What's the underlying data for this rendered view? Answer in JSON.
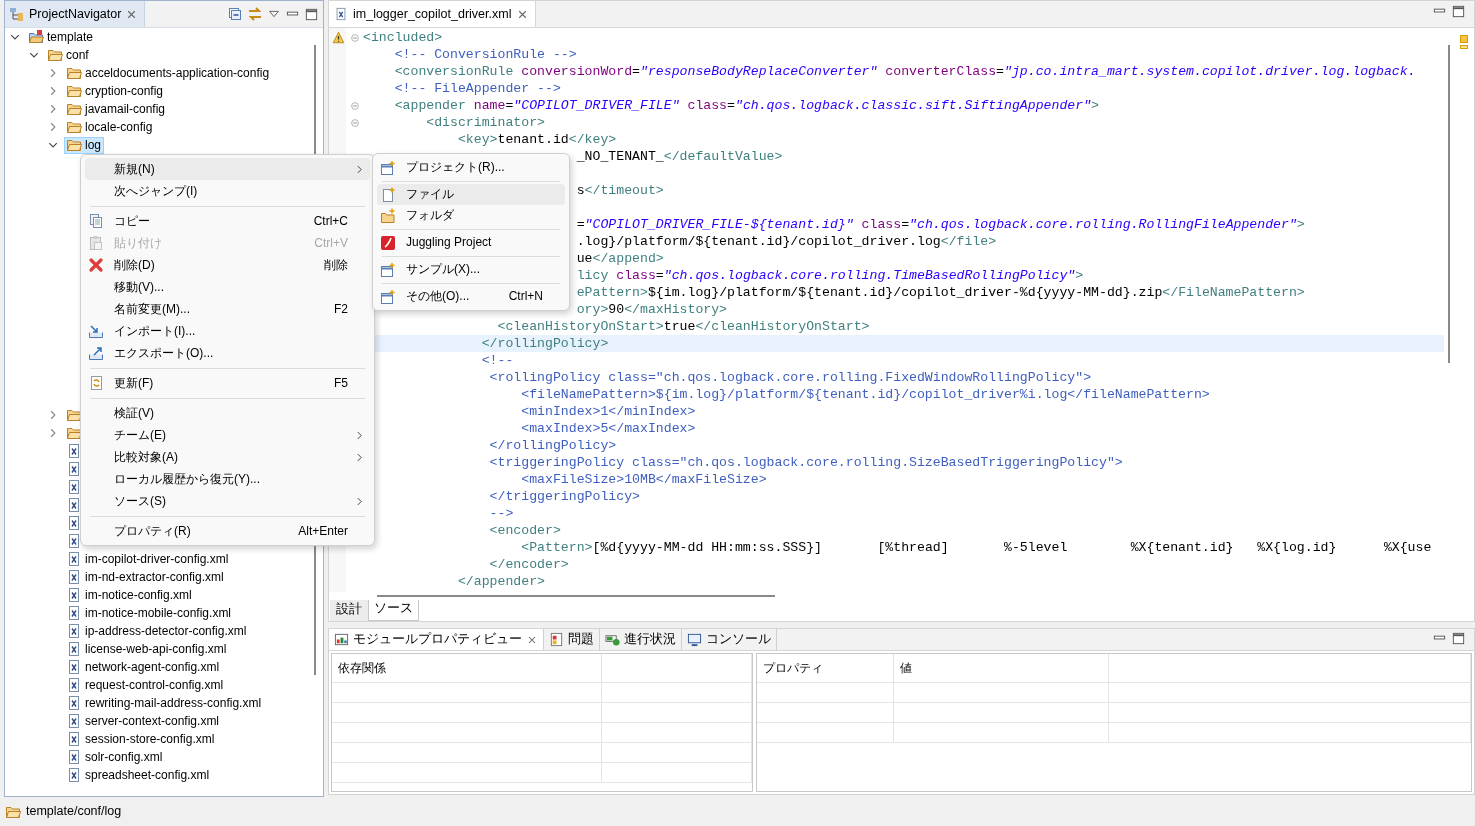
{
  "navigator": {
    "title": "ProjectNavigator",
    "tree": [
      {
        "kind": "project",
        "label": "template",
        "expanded": true,
        "selected": false,
        "children": [
          {
            "kind": "folder",
            "label": "conf",
            "expanded": true,
            "selected": false,
            "children": [
              {
                "kind": "folder",
                "label": "acceldocuments-application-config",
                "expanded": false,
                "selected": false
              },
              {
                "kind": "folder",
                "label": "cryption-config",
                "expanded": false,
                "selected": false
              },
              {
                "kind": "folder",
                "label": "javamail-config",
                "expanded": false,
                "selected": false
              },
              {
                "kind": "folder",
                "label": "locale-config",
                "expanded": false,
                "selected": false
              },
              {
                "kind": "folder",
                "label": "log",
                "expanded": true,
                "selected": true
              },
              {
                "kind": "folder",
                "expanded": false,
                "selected": false
              },
              {
                "kind": "folder",
                "expanded": false,
                "selected": false
              },
              {
                "kind": "file",
                "selected": false
              },
              {
                "kind": "file",
                "selected": false
              },
              {
                "kind": "file",
                "selected": false
              },
              {
                "kind": "file",
                "selected": false
              },
              {
                "kind": "file",
                "selected": false
              },
              {
                "kind": "file",
                "selected": false
              },
              {
                "kind": "file",
                "label": "im-copilot-driver-config.xml",
                "selected": false
              },
              {
                "kind": "file",
                "label": "im-nd-extractor-config.xml",
                "selected": false
              },
              {
                "kind": "file",
                "label": "im-notice-config.xml",
                "selected": false
              },
              {
                "kind": "file",
                "label": "im-notice-mobile-config.xml",
                "selected": false
              },
              {
                "kind": "file",
                "label": "ip-address-detector-config.xml",
                "selected": false
              },
              {
                "kind": "file",
                "label": "license-web-api-config.xml",
                "selected": false
              },
              {
                "kind": "file",
                "label": "network-agent-config.xml",
                "selected": false
              },
              {
                "kind": "file",
                "label": "request-control-config.xml",
                "selected": false
              },
              {
                "kind": "file",
                "label": "rewriting-mail-address-config.xml",
                "selected": false
              },
              {
                "kind": "file",
                "label": "server-context-config.xml",
                "selected": false
              },
              {
                "kind": "file",
                "label": "session-store-config.xml",
                "selected": false
              },
              {
                "kind": "file",
                "label": "solr-config.xml",
                "selected": false
              },
              {
                "kind": "file",
                "label": "spreadsheet-config.xml",
                "selected": false
              }
            ]
          }
        ]
      }
    ]
  },
  "editor": {
    "tab": {
      "title": "im_logger_copilot_driver.xml"
    },
    "lines": [
      {
        "segments": [
          {
            "kind": "tag",
            "text": "<included>"
          }
        ],
        "fold": true,
        "warning": true,
        "current": false
      },
      {
        "segments": [
          {
            "kind": "comment",
            "text": "    <!-- ConversionRule -->"
          }
        ],
        "fold": false,
        "warning": false,
        "current": false
      },
      {
        "segments": [
          {
            "kind": "tag",
            "text": "    <conversionRule "
          },
          {
            "kind": "attr",
            "text": "conversionWord"
          },
          {
            "kind": "text",
            "text": "="
          },
          {
            "kind": "value",
            "text": "\"responseBodyReplaceConverter\" "
          },
          {
            "kind": "attr",
            "text": "converterClass"
          },
          {
            "kind": "text",
            "text": "="
          },
          {
            "kind": "value",
            "text": "\"jp.co.intra_mart.system.copilot.driver.log.logback."
          }
        ],
        "fold": false,
        "warning": false,
        "current": false
      },
      {
        "segments": [
          {
            "kind": "comment",
            "text": "    <!-- FileAppender -->"
          }
        ],
        "fold": false,
        "warning": false,
        "current": false
      },
      {
        "segments": [
          {
            "kind": "tag",
            "text": "    <appender "
          },
          {
            "kind": "attr",
            "text": "name"
          },
          {
            "kind": "text",
            "text": "="
          },
          {
            "kind": "value",
            "text": "\"COPILOT_DRIVER_FILE\" "
          },
          {
            "kind": "attr",
            "text": "class"
          },
          {
            "kind": "text",
            "text": "="
          },
          {
            "kind": "value",
            "text": "\"ch.qos.logback.classic.sift.SiftingAppender\""
          },
          {
            "kind": "tag",
            "text": ">"
          }
        ],
        "fold": true,
        "warning": false,
        "current": false
      },
      {
        "segments": [
          {
            "kind": "tag",
            "text": "        <discriminator>"
          }
        ],
        "fold": true,
        "warning": false,
        "current": false
      },
      {
        "segments": [
          {
            "kind": "tag",
            "text": "            <key>"
          },
          {
            "kind": "text",
            "text": "tenant.id"
          },
          {
            "kind": "tag",
            "text": "</key>"
          }
        ],
        "fold": false,
        "warning": false,
        "current": false
      },
      {
        "segments": [
          {
            "kind": "text",
            "text": "                           _NO_TENANT_"
          },
          {
            "kind": "tag",
            "text": "</defaultValue>"
          }
        ],
        "fold": false,
        "warning": false,
        "current": false
      },
      {
        "fold": false,
        "warning": false,
        "current": false
      },
      {
        "segments": [
          {
            "kind": "text",
            "text": "                           s"
          },
          {
            "kind": "tag",
            "text": "</timeout>"
          }
        ],
        "fold": false,
        "warning": false,
        "current": false
      },
      {
        "fold": false,
        "warning": false,
        "current": false
      },
      {
        "segments": [
          {
            "kind": "text",
            "text": "                           ="
          },
          {
            "kind": "value",
            "text": "\"COPILOT_DRIVER_FILE-${tenant.id}\" "
          },
          {
            "kind": "attr",
            "text": "class"
          },
          {
            "kind": "text",
            "text": "="
          },
          {
            "kind": "value",
            "text": "\"ch.qos.logback.core.rolling.RollingFileAppender\""
          },
          {
            "kind": "tag",
            "text": ">"
          }
        ],
        "fold": false,
        "warning": false,
        "current": false
      },
      {
        "segments": [
          {
            "kind": "text",
            "text": "                           .log}/platform/${tenant.id}/copilot_driver.log"
          },
          {
            "kind": "tag",
            "text": "</file>"
          }
        ],
        "fold": false,
        "warning": false,
        "current": false
      },
      {
        "segments": [
          {
            "kind": "text",
            "text": "                           ue"
          },
          {
            "kind": "tag",
            "text": "</append>"
          }
        ],
        "fold": false,
        "warning": false,
        "current": false
      },
      {
        "segments": [
          {
            "kind": "tag",
            "text": "                           licy "
          },
          {
            "kind": "attr",
            "text": "class"
          },
          {
            "kind": "text",
            "text": "="
          },
          {
            "kind": "value",
            "text": "\"ch.qos.logback.core.rolling.TimeBasedRollingPolicy\""
          },
          {
            "kind": "tag",
            "text": ">"
          }
        ],
        "fold": false,
        "warning": false,
        "current": false
      },
      {
        "segments": [
          {
            "kind": "tag",
            "text": "                           ePattern>"
          },
          {
            "kind": "text",
            "text": "${im.log}/platform/${tenant.id}/copilot_driver-%d{yyyy-MM-dd}.zip"
          },
          {
            "kind": "tag",
            "text": "</FileNamePattern>"
          }
        ],
        "fold": false,
        "warning": false,
        "current": false
      },
      {
        "segments": [
          {
            "kind": "tag",
            "text": "                           ory>"
          },
          {
            "kind": "text",
            "text": "90"
          },
          {
            "kind": "tag",
            "text": "</maxHistory>"
          }
        ],
        "fold": false,
        "warning": false,
        "current": false
      },
      {
        "segments": [
          {
            "kind": "tag",
            "text": "                 <cleanHistoryOnStart>"
          },
          {
            "kind": "text",
            "text": "true"
          },
          {
            "kind": "tag",
            "text": "</cleanHistoryOnStart>"
          }
        ],
        "fold": false,
        "warning": false,
        "current": false
      },
      {
        "segments": [
          {
            "kind": "tag",
            "text": "               </rollingPolicy>"
          }
        ],
        "fold": false,
        "warning": false,
        "current": true
      },
      {
        "segments": [
          {
            "kind": "comment",
            "text": "               <!--"
          }
        ],
        "fold": false,
        "warning": false,
        "current": false
      },
      {
        "segments": [
          {
            "kind": "comment",
            "text": "                <rollingPolicy class=\"ch.qos.logback.core.rolling.FixedWindowRollingPolicy\">"
          }
        ],
        "fold": false,
        "warning": false,
        "current": false
      },
      {
        "segments": [
          {
            "kind": "comment",
            "text": "                    <fileNamePattern>${im.log}/platform/${tenant.id}/copilot_driver%i.log</fileNamePattern>"
          }
        ],
        "fold": false,
        "warning": false,
        "current": false
      },
      {
        "segments": [
          {
            "kind": "comment",
            "text": "                    <minIndex>1</minIndex>"
          }
        ],
        "fold": false,
        "warning": false,
        "current": false
      },
      {
        "segments": [
          {
            "kind": "comment",
            "text": "                    <maxIndex>5</maxIndex>"
          }
        ],
        "fold": false,
        "warning": false,
        "current": false
      },
      {
        "segments": [
          {
            "kind": "comment",
            "text": "                </rollingPolicy>"
          }
        ],
        "fold": false,
        "warning": false,
        "current": false
      },
      {
        "segments": [
          {
            "kind": "comment",
            "text": "                <triggeringPolicy class=\"ch.qos.logback.core.rolling.SizeBasedTriggeringPolicy\">"
          }
        ],
        "fold": false,
        "warning": false,
        "current": false
      },
      {
        "segments": [
          {
            "kind": "comment",
            "text": "                    <maxFileSize>10MB</maxFileSize>"
          }
        ],
        "fold": false,
        "warning": false,
        "current": false
      },
      {
        "segments": [
          {
            "kind": "comment",
            "text": "                </triggeringPolicy>"
          }
        ],
        "fold": false,
        "warning": false,
        "current": false
      },
      {
        "segments": [
          {
            "kind": "comment",
            "text": "                -->"
          }
        ],
        "fold": false,
        "warning": false,
        "current": false
      },
      {
        "segments": [
          {
            "kind": "tag",
            "text": "                <encoder>"
          }
        ],
        "fold": false,
        "warning": false,
        "current": false
      },
      {
        "segments": [
          {
            "kind": "tag",
            "text": "                    <Pattern>"
          },
          {
            "kind": "text",
            "text": "[%d{yyyy-MM-dd HH:mm:ss.SSS}]       [%thread]       %-5level        %X{tenant.id}   %X{log.id}      %X{use"
          }
        ],
        "fold": false,
        "warning": false,
        "current": false
      },
      {
        "segments": [
          {
            "kind": "tag",
            "text": "                </encoder>"
          }
        ],
        "fold": false,
        "warning": false,
        "current": false
      },
      {
        "segments": [
          {
            "kind": "tag",
            "text": "            </appender>"
          }
        ],
        "fold": false,
        "warning": false,
        "current": false
      }
    ],
    "view_tabs": [
      {
        "label": "設計",
        "selected": false
      },
      {
        "label": "ソース",
        "selected": true
      }
    ]
  },
  "context_menu": {
    "items": [
      {
        "kind": "item",
        "label": "新規(N)",
        "submenu": true,
        "selected": true,
        "disabled": false
      },
      {
        "kind": "item",
        "label": "次へジャンプ(I)",
        "submenu": false,
        "selected": false,
        "disabled": false
      },
      {
        "kind": "separator"
      },
      {
        "kind": "item",
        "label": "コピー",
        "shortcut": "Ctrl+C",
        "submenu": false,
        "selected": false,
        "disabled": false
      },
      {
        "kind": "item",
        "label": "貼り付け",
        "shortcut": "Ctrl+V",
        "submenu": false,
        "selected": false,
        "disabled": true
      },
      {
        "kind": "item",
        "label": "削除(D)",
        "shortcut": "削除",
        "submenu": false,
        "selected": false,
        "disabled": false
      },
      {
        "kind": "item",
        "label": "移動(V)...",
        "submenu": false,
        "selected": false,
        "disabled": false
      },
      {
        "kind": "item",
        "label": "名前変更(M)...",
        "shortcut": "F2",
        "submenu": false,
        "selected": false,
        "disabled": false
      },
      {
        "kind": "item",
        "label": "インポート(I)...",
        "submenu": false,
        "selected": false,
        "disabled": false
      },
      {
        "kind": "item",
        "label": "エクスポート(O)...",
        "submenu": false,
        "selected": false,
        "disabled": false
      },
      {
        "kind": "separator"
      },
      {
        "kind": "item",
        "label": "更新(F)",
        "shortcut": "F5",
        "submenu": false,
        "selected": false,
        "disabled": false
      },
      {
        "kind": "separator"
      },
      {
        "kind": "item",
        "label": "検証(V)",
        "submenu": false,
        "selected": false,
        "disabled": false
      },
      {
        "kind": "item",
        "label": "チーム(E)",
        "submenu": true,
        "selected": false,
        "disabled": false
      },
      {
        "kind": "item",
        "label": "比較対象(A)",
        "submenu": true,
        "selected": false,
        "disabled": false
      },
      {
        "kind": "item",
        "label": "ローカル履歴から復元(Y)...",
        "submenu": false,
        "selected": false,
        "disabled": false
      },
      {
        "kind": "item",
        "label": "ソース(S)",
        "submenu": true,
        "selected": false,
        "disabled": false
      },
      {
        "kind": "separator"
      },
      {
        "kind": "item",
        "label": "プロパティ(R)",
        "shortcut": "Alt+Enter",
        "submenu": false,
        "selected": false,
        "disabled": false
      }
    ]
  },
  "submenu": {
    "items": [
      {
        "kind": "item",
        "label": "プロジェクト(R)...",
        "submenu": false,
        "selected": false,
        "disabled": false
      },
      {
        "kind": "separator"
      },
      {
        "kind": "item",
        "label": "ファイル",
        "submenu": false,
        "selected": true,
        "disabled": false
      },
      {
        "kind": "item",
        "label": "フォルダ",
        "submenu": false,
        "selected": false,
        "disabled": false
      },
      {
        "kind": "separator"
      },
      {
        "kind": "item",
        "label": "Juggling Project",
        "submenu": false,
        "selected": false,
        "disabled": false
      },
      {
        "kind": "separator"
      },
      {
        "kind": "item",
        "label": "サンプル(X)...",
        "submenu": false,
        "selected": false,
        "disabled": false
      },
      {
        "kind": "separator"
      },
      {
        "kind": "item",
        "label": "その他(O)...",
        "shortcut": "Ctrl+N",
        "submenu": false,
        "selected": false,
        "disabled": false
      }
    ]
  },
  "bottom_panel": {
    "tabs": [
      {
        "label": "モジュールプロパティビュー",
        "selected": true,
        "closable": true
      },
      {
        "label": "問題",
        "selected": false,
        "closable": false
      },
      {
        "label": "進行状況",
        "selected": false,
        "closable": false
      },
      {
        "label": "コンソール",
        "selected": false,
        "closable": false
      }
    ],
    "dependencies": {
      "columns": [
        "依存関係"
      ]
    },
    "properties": {
      "columns": [
        "プロパティ",
        "値"
      ]
    }
  },
  "status_bar": {
    "path": "template/conf/log"
  }
}
